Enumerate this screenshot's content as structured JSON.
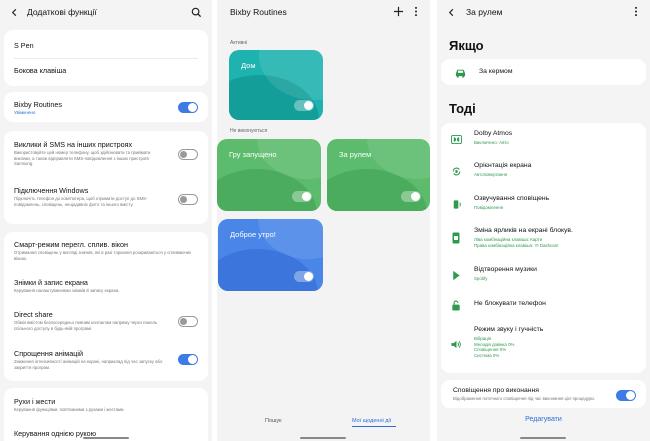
{
  "panel1": {
    "title": "Додаткові функції",
    "rows": [
      {
        "title": "S Pen"
      },
      {
        "title": "Бокова клавіша"
      },
      {
        "title": "Bixby Routines",
        "subtitle": "Увімкнено",
        "toggle": "on"
      },
      {
        "title": "Виклики й SMS на інших пристроях",
        "subtitle": "Використовуйте цей номер телефону, щоб здійснювати та приймати виклики, а також відправляти SMS-повідомлення з інших пристроїв Samsung.",
        "toggle": "off"
      },
      {
        "title": "Підключення Windows",
        "subtitle": "Підключіть телефон до комп'ютера, щоб отримати доступ до SMS-повідомлень, сповіщень, нещодавніх фото та іншого вмісту.",
        "toggle": "off"
      },
      {
        "title": "Смарт-режим перегл. сплив. вікон",
        "subtitle": "Отримання сповіщень у вигляді значків, які в разі торкання розкриваються у спливаючих вікнах."
      },
      {
        "title": "Знімки й запис екрана",
        "subtitle": "Керування налаштуваннями знімків й запису екрана."
      },
      {
        "title": "Direct share",
        "subtitle": "Обмін вмістом безпосередньо певним контактам напряму через панель спільного доступу в будь-якій програмі.",
        "toggle": "off"
      },
      {
        "title": "Спрощення анімацій",
        "subtitle": "Зниження інтенсивності анімацій на екрані, наприклад під час запуску або закриття програм.",
        "toggle": "on"
      },
      {
        "title": "Рухи і жести",
        "subtitle": "Керування функціями, пов'язаними з рухами і жестами."
      },
      {
        "title": "Керування однією рукою"
      }
    ]
  },
  "panel2": {
    "title": "Bixby Routines",
    "active_label": "Активні",
    "inactive_label": "Не виконуються",
    "tiles": [
      {
        "name": "Дом"
      },
      {
        "name": "Гру запущено"
      },
      {
        "name": "За рулем"
      },
      {
        "name": "Доброе утро!"
      }
    ],
    "nav": {
      "discover": "Пошук",
      "my_routines": "Мої щоденні дії"
    }
  },
  "panel3": {
    "title": "За рулем",
    "if_heading": "Якщо",
    "if_item": "За кермом",
    "then_heading": "Тоді",
    "actions": [
      {
        "title": "Dolby Atmos",
        "sub": [
          "Виключено: Авто"
        ],
        "icon": "dolby-icon"
      },
      {
        "title": "Орієнтація екрана",
        "sub": [
          "Автоповертання"
        ],
        "icon": "rotate-icon"
      },
      {
        "title": "Озвучування сповіщень",
        "sub": [
          "Повідомлення"
        ],
        "icon": "speak-icon"
      },
      {
        "title": "Зміна ярликів на екрані блокув.",
        "sub": [
          "Ліва комбінаційна клавіша: Карти",
          "Права комбінаційна клавіша: YI Dashcam"
        ],
        "icon": "lock-phone-icon"
      },
      {
        "title": "Відтворення музики",
        "sub": [
          "Spotify"
        ],
        "icon": "play-icon"
      },
      {
        "title": "Не блокувати телефон",
        "sub": [],
        "icon": "unlock-icon"
      },
      {
        "title": "Режим звуку і гучність",
        "sub": [
          "Вібрація",
          "Мелодія дзвінка 0%",
          "Сповіщення 0%",
          "Система 0%"
        ],
        "icon": "volume-icon"
      }
    ],
    "notify_title": "Сповіщення про виконання",
    "notify_sub": "Відображення поточного сповіщення під час виконання цієї процедури.",
    "edit_label": "Редагувати"
  },
  "colors": {
    "accent": "#3e7be6",
    "teal": "#1fb3b0",
    "green": "#58b96a",
    "blue_tile": "#4a86e8",
    "action_icon_green": "#2e9a4e"
  }
}
